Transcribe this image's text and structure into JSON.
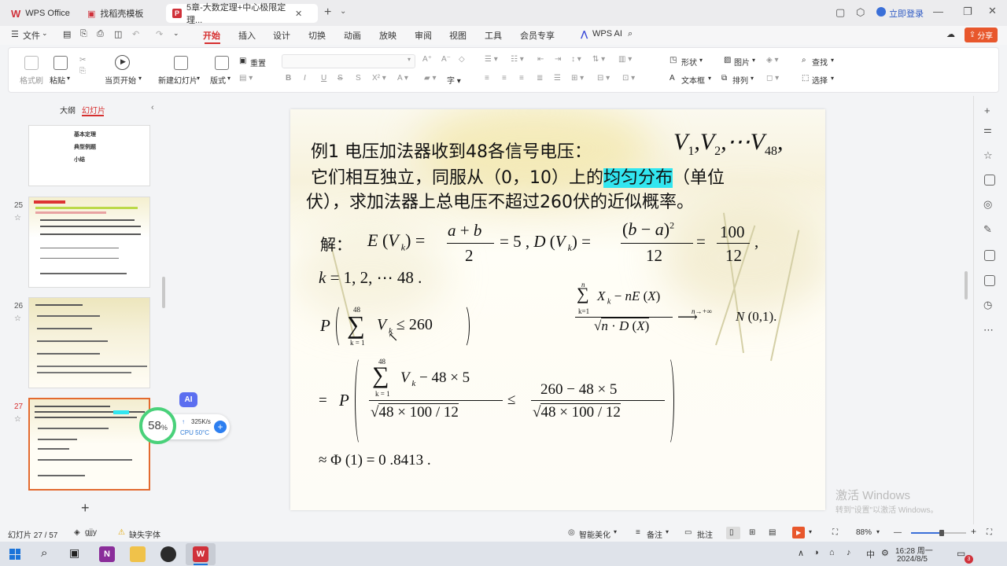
{
  "titlebar": {
    "tabs": [
      {
        "label": "WPS Office"
      },
      {
        "label": "找稻壳模板"
      },
      {
        "label": "5章-大数定理+中心极限定理..."
      }
    ],
    "login": "立即登录",
    "share": "分享"
  },
  "menu": {
    "file": "文件",
    "items": [
      "开始",
      "插入",
      "设计",
      "切换",
      "动画",
      "放映",
      "审阅",
      "视图",
      "工具",
      "会员专享"
    ],
    "wps_ai": "WPS AI"
  },
  "ribbon": {
    "format_painter": "格式刷",
    "paste": "粘贴",
    "play_from_current": "当页开始",
    "new_slide": "新建幻灯片",
    "layout": "版式",
    "reset": "重置",
    "shape": "形状",
    "picture": "图片",
    "textbox": "文本框",
    "arrange": "排列",
    "find": "查找",
    "select": "选择"
  },
  "left_panel": {
    "tab_outline": "大纲",
    "tab_slides": "幻灯片",
    "thumb_top_lines": [
      "基本定理",
      "典型例题",
      "小结"
    ],
    "slide_numbers": [
      "25",
      "26",
      "27"
    ],
    "add_slide": "+"
  },
  "slide": {
    "line1": "例1 电压加法器收到48各信号电压：",
    "line2_pre": "它们相互独立，同服从（0，10）上的",
    "line2_hl": "均匀分布",
    "line2_post": "（单位",
    "line3": "伏），求加法器上总电压不超过260伏的近似概率。",
    "solution_label": "解：",
    "k_range": "k = 1,2,⋯ 48 .",
    "result": "≈ Φ (1) = 0 .8413 ."
  },
  "overlay": {
    "ai_badge": "AI",
    "percent": "58",
    "percent_unit": "%",
    "net_speed": "325K/s",
    "cpu": "CPU 50°C"
  },
  "statusbar": {
    "slide_info": "幻灯片 27 / 57",
    "theme": "gjjy",
    "missing_font": "缺失字体",
    "beautify": "智能美化",
    "notes": "备注",
    "comments": "批注",
    "zoom": "88%"
  },
  "watermark": {
    "line1": "激活 Windows",
    "line2": "转到\"设置\"以激活 Windows。"
  },
  "taskbar": {
    "ime": "中",
    "time": "16:28 周一",
    "date": "2024/8/5",
    "notif": "3"
  },
  "colors": {
    "accent": "#d62f2f",
    "highlight": "#32e6f0",
    "share_button": "#e8572c",
    "selected_thumb": "#e36a2f"
  }
}
